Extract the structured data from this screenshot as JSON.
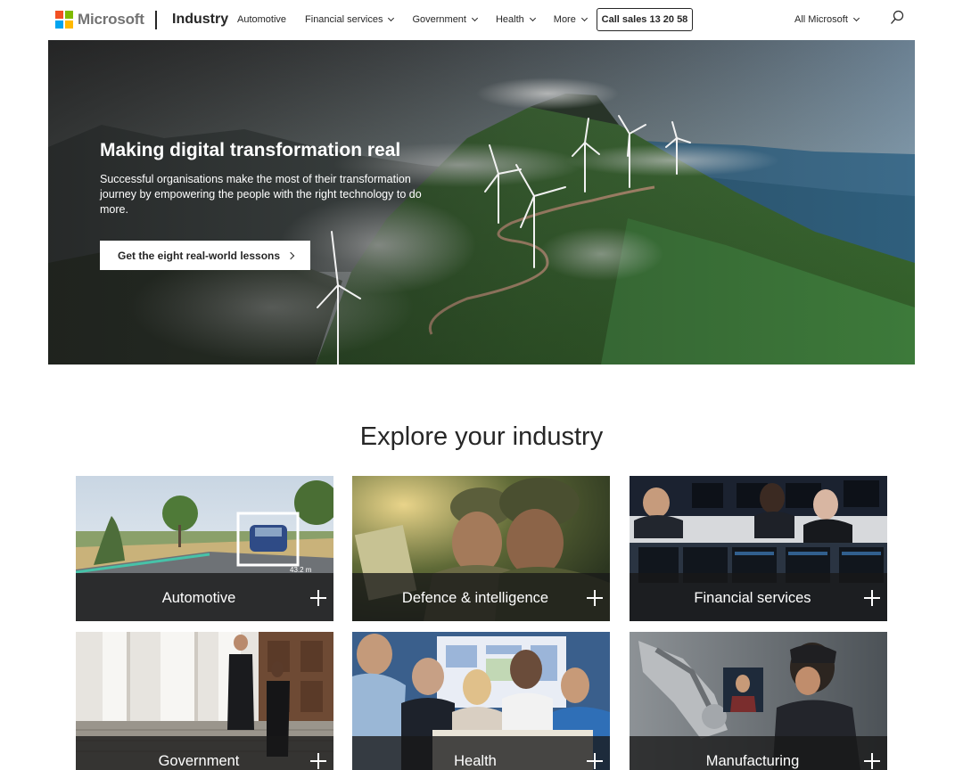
{
  "header": {
    "brand": "Microsoft",
    "site_title": "Industry",
    "nav": [
      {
        "label": "Automotive",
        "has_dropdown": false
      },
      {
        "label": "Financial services",
        "has_dropdown": true
      },
      {
        "label": "Government",
        "has_dropdown": true
      },
      {
        "label": "Health",
        "has_dropdown": true
      },
      {
        "label": "More",
        "has_dropdown": true
      }
    ],
    "call_button": "Call sales 13 20 58",
    "all_microsoft": "All Microsoft",
    "icons": {
      "search": "search-icon",
      "chevron": "chevron-down-icon"
    },
    "logo_colors": [
      "#f25022",
      "#7fba00",
      "#00a4ef",
      "#ffb900"
    ]
  },
  "hero": {
    "title": "Making digital transformation real",
    "text": "Successful organisations make the most of their transformation journey by empowering the people with the right technology to do more.",
    "cta": "Get the eight real-world lessons"
  },
  "explore": {
    "title": "Explore your industry",
    "tiles": [
      {
        "label": "Automotive"
      },
      {
        "label": "Defence & intelligence"
      },
      {
        "label": "Financial services"
      },
      {
        "label": "Government"
      },
      {
        "label": "Health"
      },
      {
        "label": "Manufacturing"
      }
    ],
    "tile_icon": "plus-icon",
    "image_text": "43.2 m"
  }
}
